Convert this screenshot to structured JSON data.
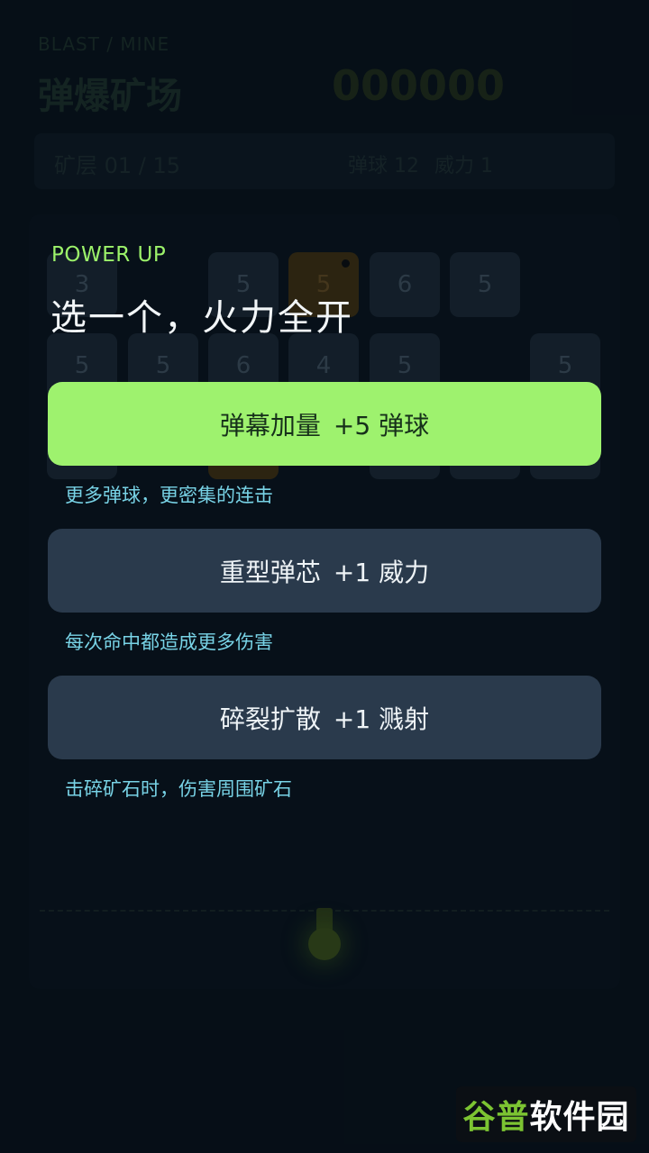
{
  "header": {
    "subtitle": "BLAST / MINE",
    "title": "弹爆矿场",
    "score": "000000"
  },
  "status": {
    "level": "矿层 01 / 15",
    "balls": "弹球 12",
    "power": "威力 1"
  },
  "board": {
    "bricks_row1": [
      "3",
      "5",
      "5",
      "6",
      "5"
    ],
    "bricks_row2": [
      "5",
      "5",
      "6",
      "4",
      "5",
      "5"
    ]
  },
  "powerup": {
    "label": "POWER UP",
    "heading": "选一个，火力全开",
    "options": [
      {
        "name": "弹幕加量",
        "effect": "+5 弹球",
        "desc": "更多弹球，更密集的连击",
        "style": "primary"
      },
      {
        "name": "重型弹芯",
        "effect": "+1 威力",
        "desc": "每次命中都造成更多伤害",
        "style": "secondary"
      },
      {
        "name": "碎裂扩散",
        "effect": "+1 溅射",
        "desc": "击碎矿石时，伤害周围矿石",
        "style": "secondary"
      }
    ]
  },
  "watermark": {
    "part1": "谷普",
    "part2": "软件园"
  },
  "colors": {
    "accent": "#9ef26e",
    "desc_text": "#78d3e6",
    "button_secondary": "#2a3a4c",
    "background": "#07101a"
  }
}
